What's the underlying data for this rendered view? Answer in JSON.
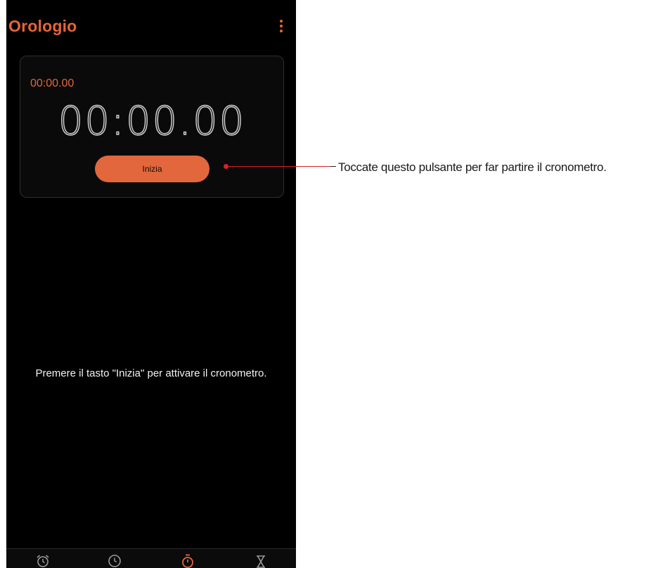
{
  "app": {
    "title": "Orologio",
    "accent_color": "#e8643a"
  },
  "app_bar": {
    "overflow_icon": "more-vert-icon"
  },
  "stopwatch": {
    "lap_time": "00:00.00",
    "main_time": "00:00.00",
    "start_label": "Inizia"
  },
  "hint_text": "Premere il tasto \"Inizia\" per attivare il cronometro.",
  "bottom_nav": {
    "items": [
      {
        "icon": "alarm-icon",
        "active": false
      },
      {
        "icon": "clock-icon",
        "active": false
      },
      {
        "icon": "stopwatch-icon",
        "active": true
      },
      {
        "icon": "timer-hourglass-icon",
        "active": false
      }
    ]
  },
  "callout": {
    "text": "Toccate questo pulsante per far partire il cronometro.",
    "color": "#d8202a"
  }
}
